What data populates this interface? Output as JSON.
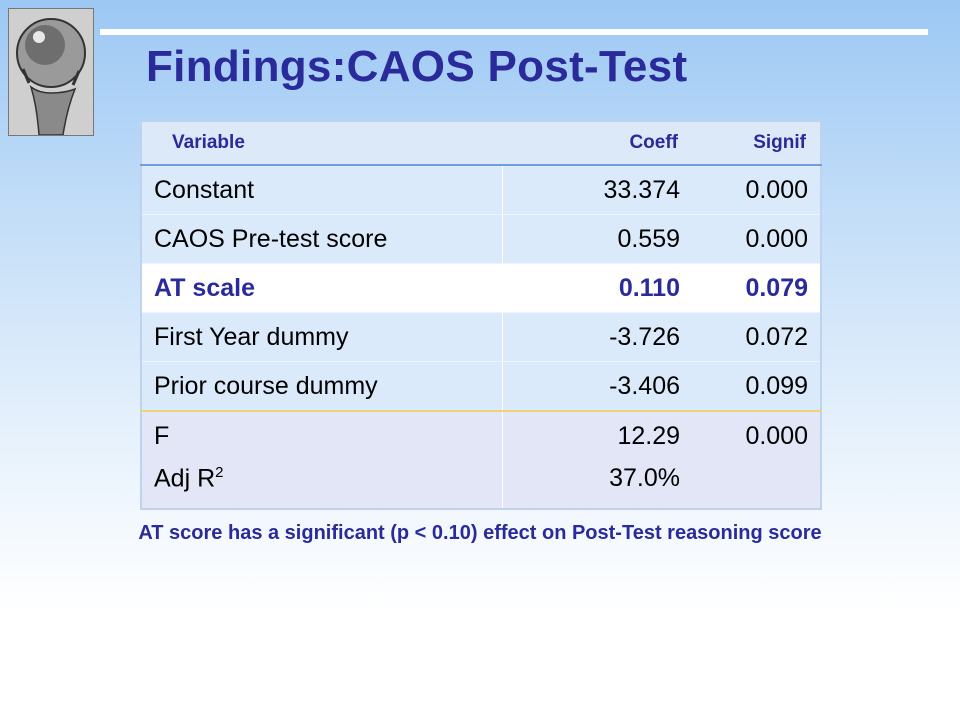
{
  "slide": {
    "title": "Findings:CAOS Post-Test",
    "note": "AT score has a significant (p < 0.10) effect on Post-Test reasoning score"
  },
  "table": {
    "headers": [
      "Variable",
      "Coeff",
      "Signif"
    ],
    "rows": [
      {
        "variable": "Constant",
        "coeff": "33.374",
        "signif": "0.000",
        "highlight": false
      },
      {
        "variable": "CAOS Pre-test score",
        "coeff": "0.559",
        "signif": "0.000",
        "highlight": false
      },
      {
        "variable": "AT scale",
        "coeff": "0.110",
        "signif": "0.079",
        "highlight": true
      },
      {
        "variable": "First Year dummy",
        "coeff": "-3.726",
        "signif": "0.072",
        "highlight": false
      },
      {
        "variable": "Prior course dummy",
        "coeff": "-3.406",
        "signif": "0.099",
        "highlight": false
      }
    ],
    "model": {
      "f_label": "F",
      "f_value": "12.29",
      "f_signif": "0.000",
      "r2_label": "Adj R",
      "r2_sup": "2",
      "r2_value": "37.0%"
    }
  },
  "colors": {
    "title": "#2a2a9a",
    "table_band": "#dbeafb",
    "highlight_text": "#2a2a9a"
  }
}
